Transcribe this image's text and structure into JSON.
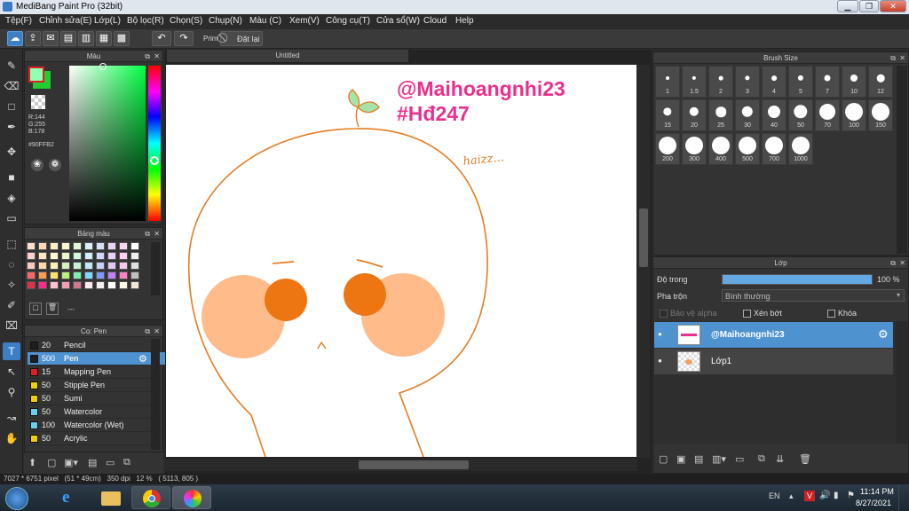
{
  "window": {
    "title": "MediBang Paint Pro (32bit)"
  },
  "menu": [
    "Tệp(F)",
    "Chỉnh sửa(E)",
    "Lớp(L)",
    "Bộ lọc(R)",
    "Chọn(S)",
    "Chụp(N)",
    "Màu (C)",
    "Xem(V)",
    "Công cụ(T)",
    "Cửa sổ(W)",
    "Cloud",
    "Help"
  ],
  "toolbar": {
    "prim_label": "Prim",
    "reset_label": "Đặt lại"
  },
  "color_panel": {
    "title": "Màu",
    "r": "R:144",
    "g": "G:255",
    "b": "B:178",
    "hex": "#90FFB2",
    "fg_color": "#90FFB2",
    "bg_color": "#22cc33"
  },
  "palette_panel": {
    "title": "Bảng màu",
    "footer": "---"
  },
  "brush_panel": {
    "title": "Cọ: Pen",
    "items": [
      {
        "size": "20",
        "name": "Pencil",
        "color": "#1e1e1e"
      },
      {
        "size": "500",
        "name": "Pen",
        "color": "#1e1e1e"
      },
      {
        "size": "15",
        "name": "Mapping Pen",
        "color": "#e02020"
      },
      {
        "size": "50",
        "name": "Stipple Pen",
        "color": "#f0d000"
      },
      {
        "size": "50",
        "name": "Sumi",
        "color": "#f0d000"
      },
      {
        "size": "50",
        "name": "Watercolor",
        "color": "#6ad0f0"
      },
      {
        "size": "100",
        "name": "Watercolor (Wet)",
        "color": "#6ad0f0"
      },
      {
        "size": "50",
        "name": "Acrylic",
        "color": "#f0d000"
      }
    ]
  },
  "canvas": {
    "tab": "Untitled",
    "handle": "@Maihoangnhi23",
    "tag": "#Hđ247",
    "note": "haizz..."
  },
  "brush_size_panel": {
    "title": "Brush Size",
    "sizes": [
      "1",
      "1.5",
      "2",
      "3",
      "4",
      "5",
      "7",
      "10",
      "12",
      "15",
      "20",
      "25",
      "30",
      "40",
      "50",
      "70",
      "100",
      "150",
      "200",
      "300",
      "400",
      "500",
      "700",
      "1000"
    ]
  },
  "layer_panel": {
    "title": "Lớp",
    "opacity_label": "Độ trong",
    "opacity_value": "100 %",
    "opacity_fraction": 1.0,
    "blend_label": "Pha trộn",
    "blend_value": "Bình thường",
    "protect_alpha": "Bảo vệ alpha",
    "clipping": "Xén bớt",
    "lock": "Khóa",
    "layers": [
      {
        "name": "@Maihoangnhi23",
        "selected": true
      },
      {
        "name": "Lớp1",
        "selected": false
      }
    ]
  },
  "status": {
    "text": "7027 * 6751 pixel   (51 * 49cm)   350 dpi   12 %   ( 5113, 805 )"
  },
  "taskbar": {
    "lang": "EN",
    "time": "11:14 PM",
    "date": "8/27/2021"
  }
}
